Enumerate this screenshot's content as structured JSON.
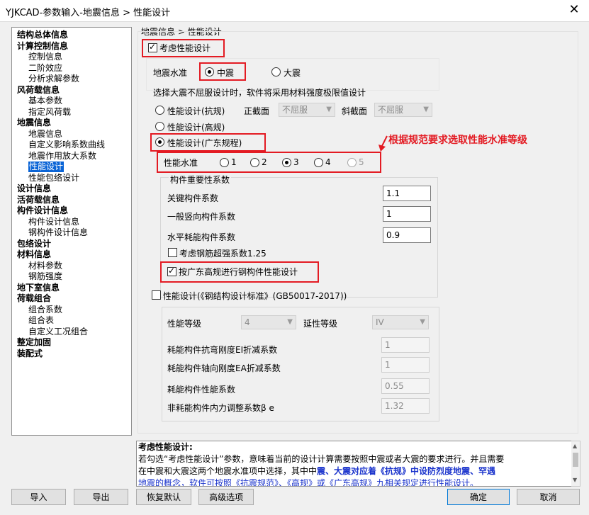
{
  "window": {
    "title": "YJKCAD-参数输入-地震信息 > 性能设计",
    "close": "✕"
  },
  "tree": {
    "items": [
      {
        "label": "结构总体信息",
        "level": 0
      },
      {
        "label": "计算控制信息",
        "level": 0
      },
      {
        "label": "控制信息",
        "level": 1
      },
      {
        "label": "二阶效应",
        "level": 1
      },
      {
        "label": "分析求解参数",
        "level": 1
      },
      {
        "label": "风荷载信息",
        "level": 0
      },
      {
        "label": "基本参数",
        "level": 1
      },
      {
        "label": "指定风荷载",
        "level": 1
      },
      {
        "label": "地震信息",
        "level": 0
      },
      {
        "label": "地震信息",
        "level": 1
      },
      {
        "label": "自定义影响系数曲线",
        "level": 1
      },
      {
        "label": "地震作用放大系数",
        "level": 1
      },
      {
        "label": "性能设计",
        "level": 1,
        "selected": true
      },
      {
        "label": "性能包络设计",
        "level": 1
      },
      {
        "label": "设计信息",
        "level": 0
      },
      {
        "label": "活荷载信息",
        "level": 0
      },
      {
        "label": "构件设计信息",
        "level": 0
      },
      {
        "label": "构件设计信息",
        "level": 1
      },
      {
        "label": "钢构件设计信息",
        "level": 1
      },
      {
        "label": "包络设计",
        "level": 0
      },
      {
        "label": "材料信息",
        "level": 0
      },
      {
        "label": "材料参数",
        "level": 1
      },
      {
        "label": "钢筋强度",
        "level": 1
      },
      {
        "label": "地下室信息",
        "level": 0
      },
      {
        "label": "荷载组合",
        "level": 0
      },
      {
        "label": "组合系数",
        "level": 1
      },
      {
        "label": "组合表",
        "level": 1
      },
      {
        "label": "自定义工况组合",
        "level": 1
      },
      {
        "label": "整定加固",
        "level": 0
      },
      {
        "label": "装配式",
        "level": 0
      }
    ]
  },
  "panel": {
    "breadcrumb": "地震信息 > 性能设计",
    "consider_perf": "考虑性能设计",
    "eq_level_label": "地震水准",
    "eq_mid": "中震",
    "eq_big": "大震",
    "big_eq_note": "选择大震不屈服设计时，软件将采用材料强度极限值设计",
    "perf_kang": "性能设计(抗规)",
    "zheng": "正截面",
    "zheng_val": "不屈服",
    "xie": "斜截面",
    "xie_val": "不屈服",
    "perf_gao": "性能设计(高规)",
    "perf_gd": "性能设计(广东规程)",
    "level_label": "性能水准",
    "levels": [
      "1",
      "2",
      "3",
      "4",
      "5"
    ],
    "importance_title": "构件重要性系数",
    "key_member": "关键构件系数",
    "key_member_val": "1.1",
    "vertical_member": "一般竖向构件系数",
    "vertical_member_val": "1",
    "horizontal_member": "水平耗能构件系数",
    "horizontal_member_val": "0.9",
    "rebar_over": "考虑钢筋超强系数1.25",
    "gd_steel": "按广东高规进行钢构件性能设计",
    "steel_std": "性能设计(《钢结构设计标准》(GB50017-2017))",
    "perf_grade": "性能等级",
    "perf_grade_val": "4",
    "ductility": "延性等级",
    "ductility_val": "IV",
    "ei_label": "耗能构件抗弯刚度EI折减系数",
    "ei_val": "1",
    "ea_label": "耗能构件轴向刚度EA折减系数",
    "ea_val": "1",
    "perf_coef_label": "耗能构件性能系数",
    "perf_coef_val": "0.55",
    "non_adj_label": "非耗能构件内力调整系数β e",
    "non_adj_val": "1.32"
  },
  "annotation": "根据规范要求选取性能水准等级",
  "description": {
    "title": "考虑性能设计:",
    "line1": "若勾选“考虑性能设计”参数，意味着当前的设计计算需要按照中震或者大震的要求进行。并且需要",
    "line2a": "在中震和大震这两个地震水准项中选择，其中中",
    "line2b": "震、大震对应着《抗规》中设防烈度地震、罕遇",
    "line3": "地震的概念，软件可按照《抗震规范》、《高规》或《广东高规》九相关规定进行性能设计。"
  },
  "buttons": {
    "import": "导入",
    "export": "导出",
    "restore": "恢复默认",
    "advanced": "高级选项",
    "ok": "确定",
    "cancel": "取消"
  },
  "colors": {
    "highlight": "#e31b23",
    "selection": "#0a64d6",
    "link": "#1a33cc"
  }
}
